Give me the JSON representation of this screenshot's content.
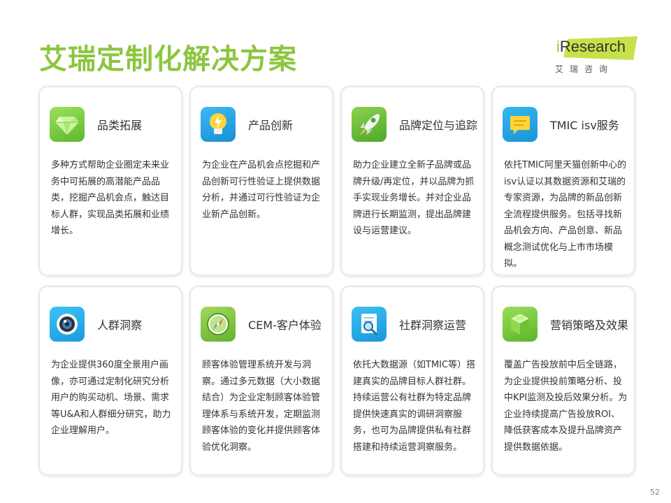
{
  "page_title": "艾瑞定制化解决方案",
  "logo": {
    "brand_i": "i",
    "brand_rest": "Research",
    "subtitle": "艾瑞咨询"
  },
  "cards": [
    {
      "title": "品类拓展",
      "icon": "diamond-icon",
      "body": "多种方式帮助企业圈定未来业务中可拓展的高潜能产品品类，挖掘产品机会点，触达目标人群，实现品类拓展和业绩增长。"
    },
    {
      "title": "产品创新",
      "icon": "lightbulb-icon",
      "body": "为企业在产品机会点挖掘和产品创新可行性验证上提供数据分析，并通过可行性验证为企业新产品创新。"
    },
    {
      "title": "品牌定位与追踪",
      "icon": "rocket-icon",
      "body": "助力企业建立全新子品牌或品牌升级/再定位，并以品牌为抓手实现业务增长。并对企业品牌进行长期监测，提出品牌建设与运营建议。"
    },
    {
      "title": "TMIC isv服务",
      "icon": "chat-icon",
      "body": "依托TMIC阿里天猫创新中心的isv认证以其数据资源和艾瑞的专家资源，为品牌的新品创新全流程提供服务。包括寻找新品机会方向、产品创意、新品概念测试优化与上市市场模拟。"
    },
    {
      "title": "人群洞察",
      "icon": "camera-lens-icon",
      "body": "为企业提供360度全景用户画像，亦可通过定制化研究分析用户的购买动机、场景、需求等U&A和人群细分研究，助力企业理解用户。"
    },
    {
      "title": "CEM-客户体验",
      "icon": "compass-icon",
      "body": "顾客体验管理系统开发与洞察。通过多元数据（大小数据结合）为企业定制顾客体验管理体系与系统开发，定期监测顾客体验的变化并提供顾客体验优化洞察。"
    },
    {
      "title": "社群洞察运营",
      "icon": "magnifier-document-icon",
      "body": "依托大数据源（如TMIC等）搭建真实的品牌目标人群社群。持续运营公有社群为特定品牌提供快速真实的调研洞察服务，也可为品牌提供私有社群搭建和持续运营洞察服务。"
    },
    {
      "title": "营销策略及效果",
      "icon": "cube-icon",
      "body": "覆盖广告投放前中后全链路，为企业提供投前策略分析、投中KPI监测及投后效果分析。为企业持续提高广告投放ROI、降低获客成本及提升品牌资产提供数据依据。"
    }
  ],
  "page_number": "52"
}
